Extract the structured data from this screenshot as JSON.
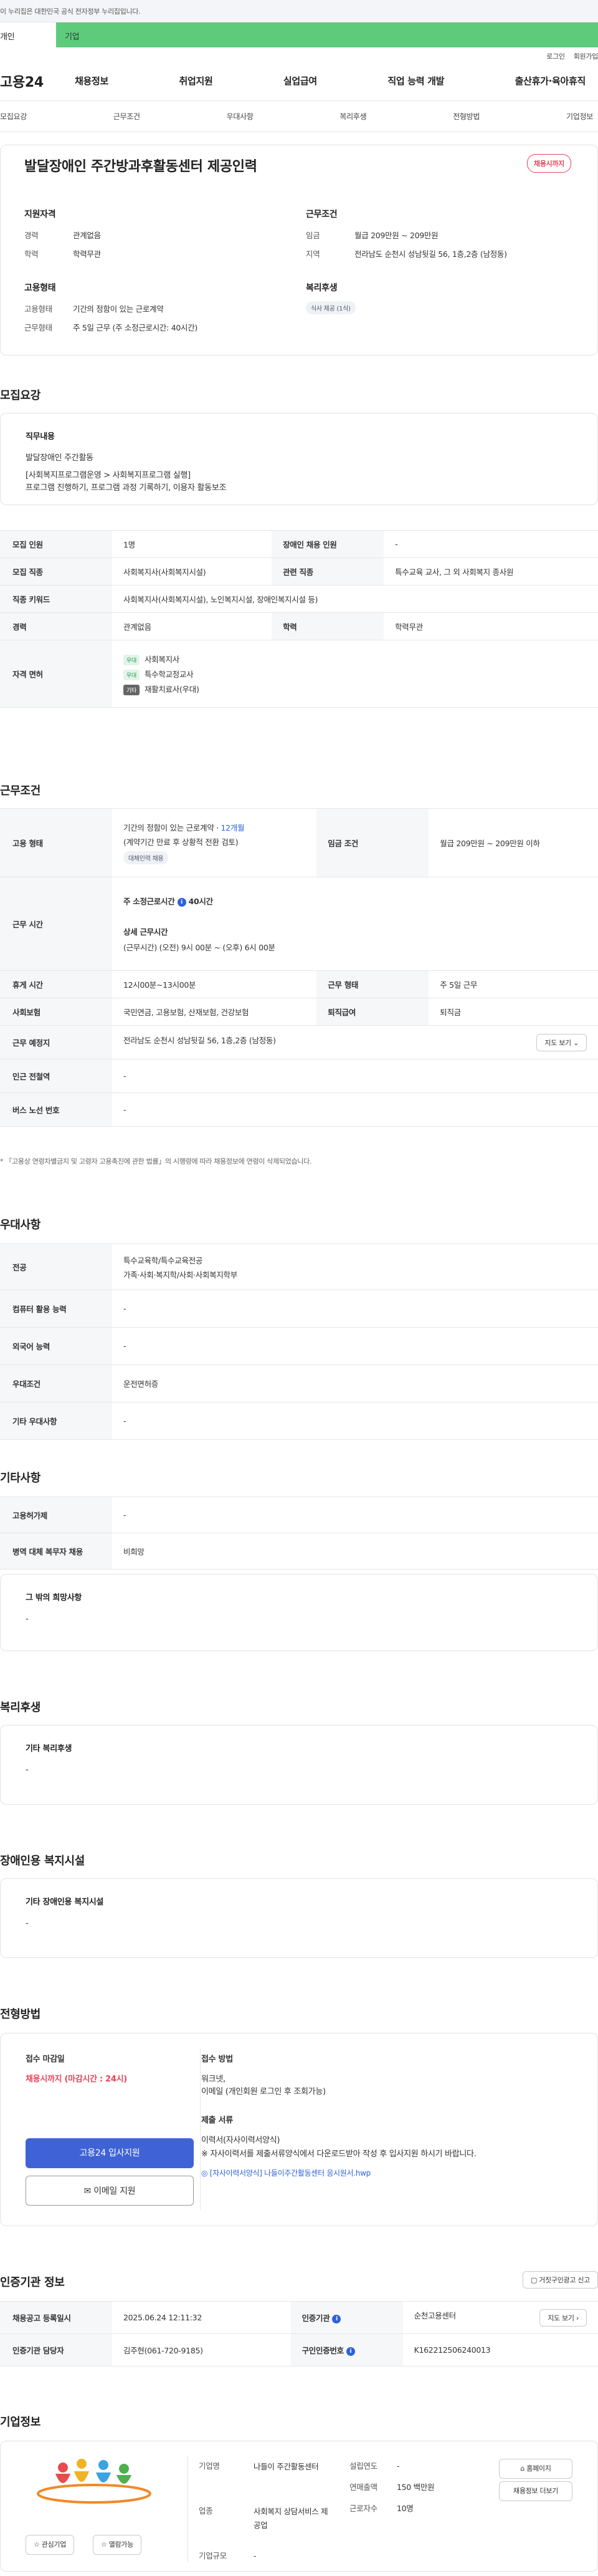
{
  "top_notice": "이 누리집은 대한민국 공식 전자정부 누리집입니다.",
  "user_tabs": {
    "personal": "개인",
    "company": "기업"
  },
  "util": [
    "로그인",
    "회원가입"
  ],
  "gnb": {
    "logo": "고용24",
    "menu": [
      "채용정보",
      "취업지원",
      "실업급여",
      "직업 능력 개발",
      "출산휴가·육아휴직"
    ]
  },
  "anchor_tabs": [
    "모집요강",
    "근무조건",
    "우대사항",
    "복리후생",
    "전형방법",
    "기업정보"
  ],
  "job": {
    "title": "발달장애인 주간방과후활동센터 제공인력",
    "status": "채용시까지",
    "qual_title": "지원자격",
    "career_k": "경력",
    "career_v": "관계없음",
    "edu_k": "학력",
    "edu_v": "학력무관",
    "cond_title": "근무조건",
    "wage_k": "임금",
    "wage_v": "월급 209만원 ~ 209만원",
    "region_k": "지역",
    "region_v": "전라남도 순천시 성남뒷길 56, 1층,2층 (남정동)",
    "emp_title": "고용형태",
    "emptype_k": "고용형태",
    "emptype_v": "기간의 정함이 있는 근로계약",
    "worktype_k": "근무형태",
    "worktype_v": "주 5일 근무 (주 소정근로시간: 40시간)",
    "welfare_title": "복리후생",
    "welfare_chip": "식사 제공 (1식)"
  },
  "recruit": {
    "heading": "모집요강",
    "duty_title": "직무내용",
    "duty_lines": [
      "발달장애인 주간활동",
      "",
      "[사회복지프로그램운영 > 사회복지프로그램 실행]",
      "프로그램 진행하기, 프로그램 과정 기록하기, 이용자 활동보조"
    ],
    "rows": {
      "count_k": "모집 인원",
      "count_v": "1명",
      "disabled_k": "장애인 채용 인원",
      "disabled_v": "-",
      "job_k": "모집 직종",
      "job_v": "사회복지사(사회복지시설)",
      "related_k": "관련 직종",
      "related_v": "특수교육 교사, 그 외 사회복지 종사원",
      "keyword_k": "직종 키워드",
      "keyword_v": "사회복지사(사회복지시설), 노인복지시설, 장애인복지시설 등)",
      "career_k": "경력",
      "career_v": "관계없음",
      "edu_k": "학력",
      "edu_v": "학력무관",
      "license_k": "자격 면허",
      "licenses": [
        {
          "tag": "우대",
          "name": "사회복지사"
        },
        {
          "tag": "우대",
          "name": "특수학교정교사"
        },
        {
          "tag": "기타",
          "name": "재활치료사(우대)"
        }
      ]
    }
  },
  "conditions": {
    "heading": "근무조건",
    "emp_k": "고용 형태",
    "emp_v1": "기간의 정함이 있는 근로계약 · ",
    "emp_v1b": "12개월",
    "emp_v2": "(계약기간 만료 후 상황적 전환 검토)",
    "emp_chip": "대체인력 채용",
    "wage_k": "임금 조건",
    "wage_v": "월급 209만원 ~ 209만원 이하",
    "time_k": "근무 시간",
    "time_main": "주 소정근로시간",
    "time_hours": "40시간",
    "time_detail_t": "상세 근무시간",
    "time_detail": "(근무시간) (오전) 9시 00분 ~ (오후) 6시 00분",
    "break_k": "휴게 시간",
    "break_v": "12시00분~13시00분",
    "shape_k": "근무 형태",
    "shape_v": "주 5일 근무",
    "insure_k": "사회보험",
    "insure_v": "국민연금, 고용보험, 산재보험, 건강보험",
    "retire_k": "퇴직급여",
    "retire_v": "퇴직금",
    "place_k": "근무 예정지",
    "place_v": "전라남도 순천시 성남뒷길 56, 1층,2층 (남정동)",
    "map_btn": "지도 보기",
    "subway_k": "인근 전철역",
    "subway_v": "-",
    "bus_k": "버스 노선 번호",
    "bus_v": "-",
    "note": "* 「고용상 연령차별금지 및 고령자 고용촉진에 관한 법률」의 시행령에 따라 채용정보에 연령이 삭제되었습니다."
  },
  "prefer": {
    "heading": "우대사항",
    "major_k": "전공",
    "major_v1": "특수교육학/특수교육전공",
    "major_v2": "가족·사회·복지학/사회·사회복지학부",
    "computer_k": "컴퓨터 활용 능력",
    "computer_v": "-",
    "lang_k": "외국어 능력",
    "lang_v": "-",
    "cond_k": "우대조건",
    "cond_v": "운전면허증",
    "etc_k": "기타 우대사항",
    "etc_v": "-"
  },
  "other": {
    "heading": "기타사항",
    "subsidy_k": "고용허가제",
    "subsidy_v": "-",
    "military_k": "병역 대체 복무자 채용",
    "military_v": "비희망",
    "hope_title": "그 밖의 희망사항",
    "hope_v": "-"
  },
  "welfare": {
    "heading": "복리후생",
    "title": "기타 복리후생",
    "value": "-"
  },
  "facility": {
    "heading": "장애인용 복지시설",
    "title": "기타 장애인용 복지시설",
    "value": "-"
  },
  "process": {
    "heading": "전형방법",
    "deadline_t": "접수 마감일",
    "deadline_v": "채용시까지 (마감시간 : 24시)",
    "apply_btn": "고용24 입사지원",
    "email_btn": "이메일 지원",
    "method_t": "접수 방법",
    "method_v1": "워크넷,",
    "method_v2": "이메일 (개인회원 로그인 후 조회가능)",
    "docs_t": "제출 서류",
    "docs_v1": "이력서(자사이력서양식)",
    "docs_v2": "※ 자사이력서를 제출서류양식에서 다운로드받아 작성 후 입사지원 하시기 바랍니다.",
    "docs_link": "[자사이력서양식] 나들이주간활동센터 응시원서.hwp"
  },
  "cert": {
    "heading": "인증기관 정보",
    "report_btn": "거짓구인광고 신고",
    "reg_k": "채용공고 등록일시",
    "reg_v": "2025.06.24 12:11:32",
    "org_k": "인증기관",
    "org_v": "순천고용센터",
    "map_btn": "지도 보기",
    "staff_k": "인증기관 담당자",
    "staff_v": "김주현(061-720-9185)",
    "num_k": "구인인증번호",
    "num_v": "K162212506240013"
  },
  "company": {
    "heading": "기업정보",
    "interest_btn": "관심기업",
    "view_btn": "열람가능",
    "name_k": "기업명",
    "name_v": "나들이 주간활동센터",
    "industry_k": "업종",
    "industry_v": "사회복지 상담서비스 제공업",
    "size_k": "기업규모",
    "size_v": "-",
    "year_k": "설립연도",
    "year_v": "-",
    "sales_k": "연매출액",
    "sales_v": "150 백만원",
    "emp_k": "근로자수",
    "emp_v": "10명",
    "home_btn": "홈페이지",
    "list_btn": "채용정보 더보기"
  }
}
